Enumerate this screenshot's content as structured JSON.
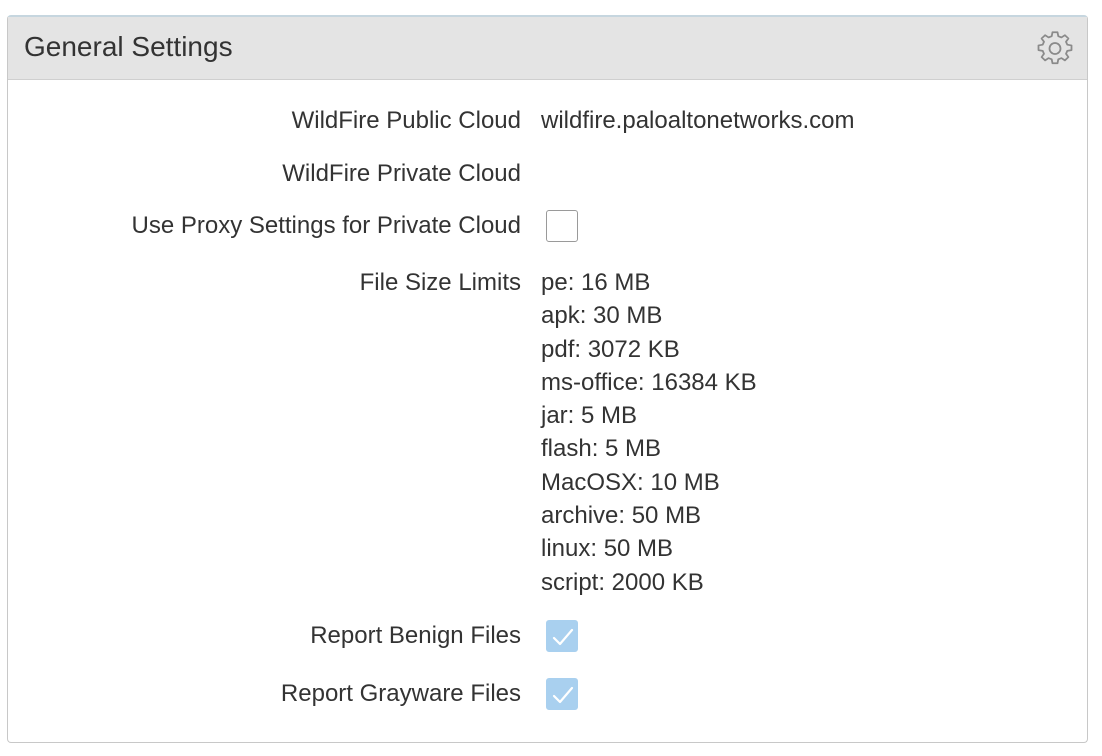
{
  "panel": {
    "title": "General Settings",
    "settings_icon": "gear-icon"
  },
  "fields": {
    "public_cloud": {
      "label": "WildFire Public Cloud",
      "value": "wildfire.paloaltonetworks.com"
    },
    "private_cloud": {
      "label": "WildFire Private Cloud",
      "value": ""
    },
    "use_proxy": {
      "label": "Use Proxy Settings for Private Cloud",
      "checked": false
    },
    "file_size_limits": {
      "label": "File Size Limits",
      "items": [
        "pe: 16 MB",
        "apk: 30 MB",
        "pdf: 3072 KB",
        "ms-office: 16384 KB",
        "jar: 5 MB",
        "flash: 5 MB",
        "MacOSX: 10 MB",
        "archive: 50 MB",
        "linux: 50 MB",
        "script: 2000 KB"
      ]
    },
    "report_benign": {
      "label": "Report Benign Files",
      "checked": true
    },
    "report_grayware": {
      "label": "Report Grayware Files",
      "checked": true
    }
  },
  "colors": {
    "header_bg": "#e4e4e4",
    "checkbox_checked": "#a9d0ef",
    "text": "#333333"
  }
}
